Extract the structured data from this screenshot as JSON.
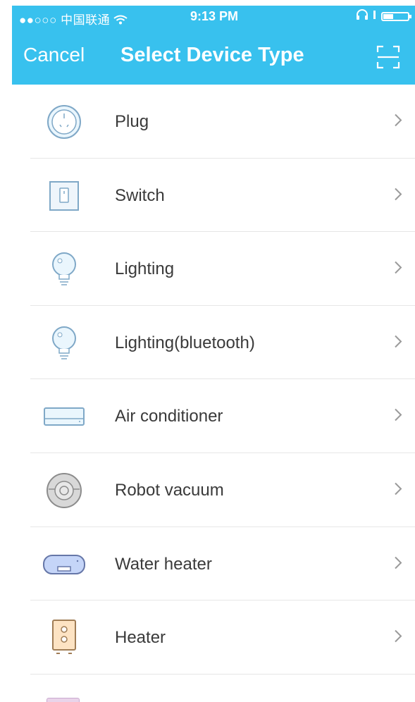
{
  "status_bar": {
    "carrier": "●●○○○ 中国联通",
    "time": "9:13 PM"
  },
  "nav": {
    "cancel_label": "Cancel",
    "title": "Select Device Type",
    "scan_icon": "scan-icon"
  },
  "devices": [
    {
      "label": "Plug",
      "icon": "plug-icon"
    },
    {
      "label": "Switch",
      "icon": "switch-icon"
    },
    {
      "label": "Lighting",
      "icon": "bulb-icon"
    },
    {
      "label": "Lighting(bluetooth)",
      "icon": "bluetooth-bulb-icon"
    },
    {
      "label": "Air conditioner",
      "icon": "air-conditioner-icon"
    },
    {
      "label": "Robot vacuum",
      "icon": "robot-vacuum-icon"
    },
    {
      "label": "Water heater",
      "icon": "water-heater-icon"
    },
    {
      "label": "Heater",
      "icon": "heater-icon"
    }
  ],
  "colors": {
    "header": "#38c1ee",
    "text": "#3a3a3a",
    "chevron": "#9a9a9a",
    "divider": "#e6e6e6"
  }
}
